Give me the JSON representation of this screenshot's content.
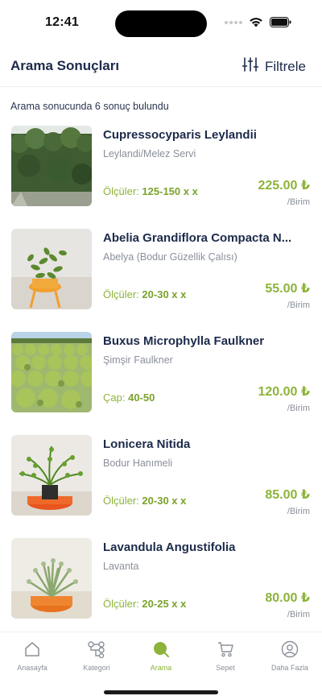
{
  "status": {
    "time": "12:41"
  },
  "header": {
    "title": "Arama Sonuçları",
    "filter_label": "Filtrele"
  },
  "results": {
    "count_text": "Arama sonucunda 6 sonuç bulundu"
  },
  "products": [
    {
      "name": "Cupressocyparis Leylandii",
      "subtitle": "Leylandi/Melez Servi",
      "dims_label": "Ölçüler:",
      "dims_value": "125-150 x  x",
      "price": "225.00 ₺",
      "unit": "/Birim"
    },
    {
      "name": "Abelia Grandiflora Compacta N...",
      "subtitle": "Abelya (Bodur Güzellik Çalısı)",
      "dims_label": "Ölçüler:",
      "dims_value": "20-30 x  x",
      "price": "55.00 ₺",
      "unit": "/Birim"
    },
    {
      "name": "Buxus Microphylla Faulkner",
      "subtitle": "Şimşir Faulkner",
      "dims_label": "Çap:",
      "dims_value": "40-50",
      "price": "120.00 ₺",
      "unit": "/Birim"
    },
    {
      "name": "Lonicera Nitida",
      "subtitle": "Bodur Hanımeli",
      "dims_label": "Ölçüler:",
      "dims_value": "20-30 x  x",
      "price": "85.00 ₺",
      "unit": "/Birim"
    },
    {
      "name": "Lavandula Angustifolia",
      "subtitle": "Lavanta",
      "dims_label": "Ölçüler:",
      "dims_value": "20-25 x  x",
      "price": "80.00 ₺",
      "unit": "/Birim"
    }
  ],
  "nav": {
    "items": [
      {
        "label": "Anasayfa",
        "icon": "home-icon"
      },
      {
        "label": "Kategori",
        "icon": "category-icon"
      },
      {
        "label": "Arama",
        "icon": "search-dot-icon",
        "active": true
      },
      {
        "label": "Sepet",
        "icon": "cart-icon"
      },
      {
        "label": "Daha Fazla",
        "icon": "profile-icon"
      }
    ]
  },
  "colors": {
    "accent_green": "#8db33a",
    "title_navy": "#1c2a4a",
    "muted_gray": "#8a8f99"
  }
}
